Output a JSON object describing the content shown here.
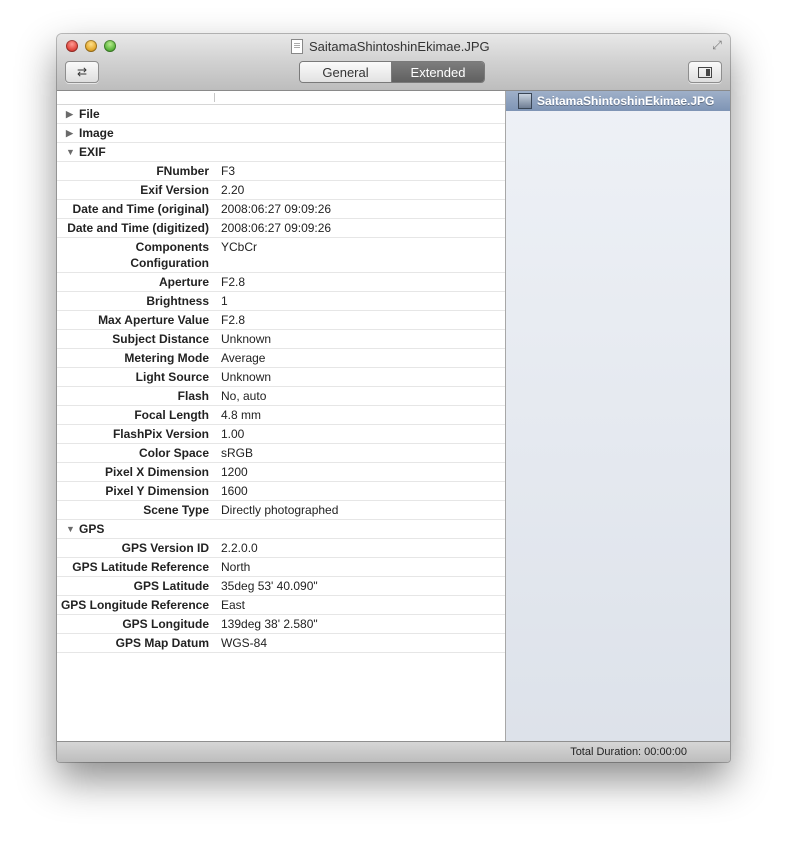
{
  "window": {
    "title": "SaitamaShintoshinEkimae.JPG",
    "tabs": [
      {
        "label": "General",
        "selected": false
      },
      {
        "label": "Extended",
        "selected": true
      }
    ]
  },
  "sections": {
    "file": {
      "name": "File",
      "expanded": false
    },
    "image": {
      "name": "Image",
      "expanded": false
    },
    "exif": {
      "name": "EXIF",
      "expanded": true,
      "rows": [
        {
          "key": "FNumber",
          "value": "F3"
        },
        {
          "key": "Exif Version",
          "value": "2.20"
        },
        {
          "key": "Date and Time (original)",
          "value": "2008:06:27 09:09:26"
        },
        {
          "key": "Date and Time (digitized)",
          "value": "2008:06:27 09:09:26"
        },
        {
          "key": "Components Configuration",
          "value": "YCbCr"
        },
        {
          "key": "Aperture",
          "value": "F2.8"
        },
        {
          "key": "Brightness",
          "value": "1"
        },
        {
          "key": "Max Aperture Value",
          "value": "F2.8"
        },
        {
          "key": "Subject Distance",
          "value": "Unknown"
        },
        {
          "key": "Metering Mode",
          "value": "Average"
        },
        {
          "key": "Light Source",
          "value": "Unknown"
        },
        {
          "key": "Flash",
          "value": "No, auto"
        },
        {
          "key": "Focal Length",
          "value": "4.8 mm"
        },
        {
          "key": "FlashPix Version",
          "value": "1.00"
        },
        {
          "key": "Color Space",
          "value": "sRGB"
        },
        {
          "key": "Pixel X Dimension",
          "value": "1200"
        },
        {
          "key": "Pixel Y Dimension",
          "value": "1600"
        },
        {
          "key": "Scene Type",
          "value": "Directly photographed"
        }
      ]
    },
    "gps": {
      "name": "GPS",
      "expanded": true,
      "rows": [
        {
          "key": "GPS Version ID",
          "value": "2.2.0.0"
        },
        {
          "key": "GPS Latitude Reference",
          "value": "North"
        },
        {
          "key": "GPS Latitude",
          "value": "35deg 53' 40.090\""
        },
        {
          "key": "GPS Longitude Reference",
          "value": "East"
        },
        {
          "key": "GPS Longitude",
          "value": "139deg 38' 2.580\""
        },
        {
          "key": "GPS Map Datum",
          "value": "WGS-84"
        }
      ]
    }
  },
  "sidebar": {
    "files": [
      {
        "name": "SaitamaShintoshinEkimae.JPG",
        "selected": true
      }
    ]
  },
  "status": {
    "duration": "Total Duration: 00:00:00"
  },
  "icons": {
    "title_doc": "document-icon",
    "swap": "swap-arrows-icon",
    "sidebar_toggle": "sidebar-toggle-icon",
    "fullscreen": "fullscreen-icon",
    "disclosure_collapsed": "triangle-right-icon",
    "disclosure_expanded": "triangle-down-icon",
    "file_thumb": "image-thumbnail-icon"
  }
}
